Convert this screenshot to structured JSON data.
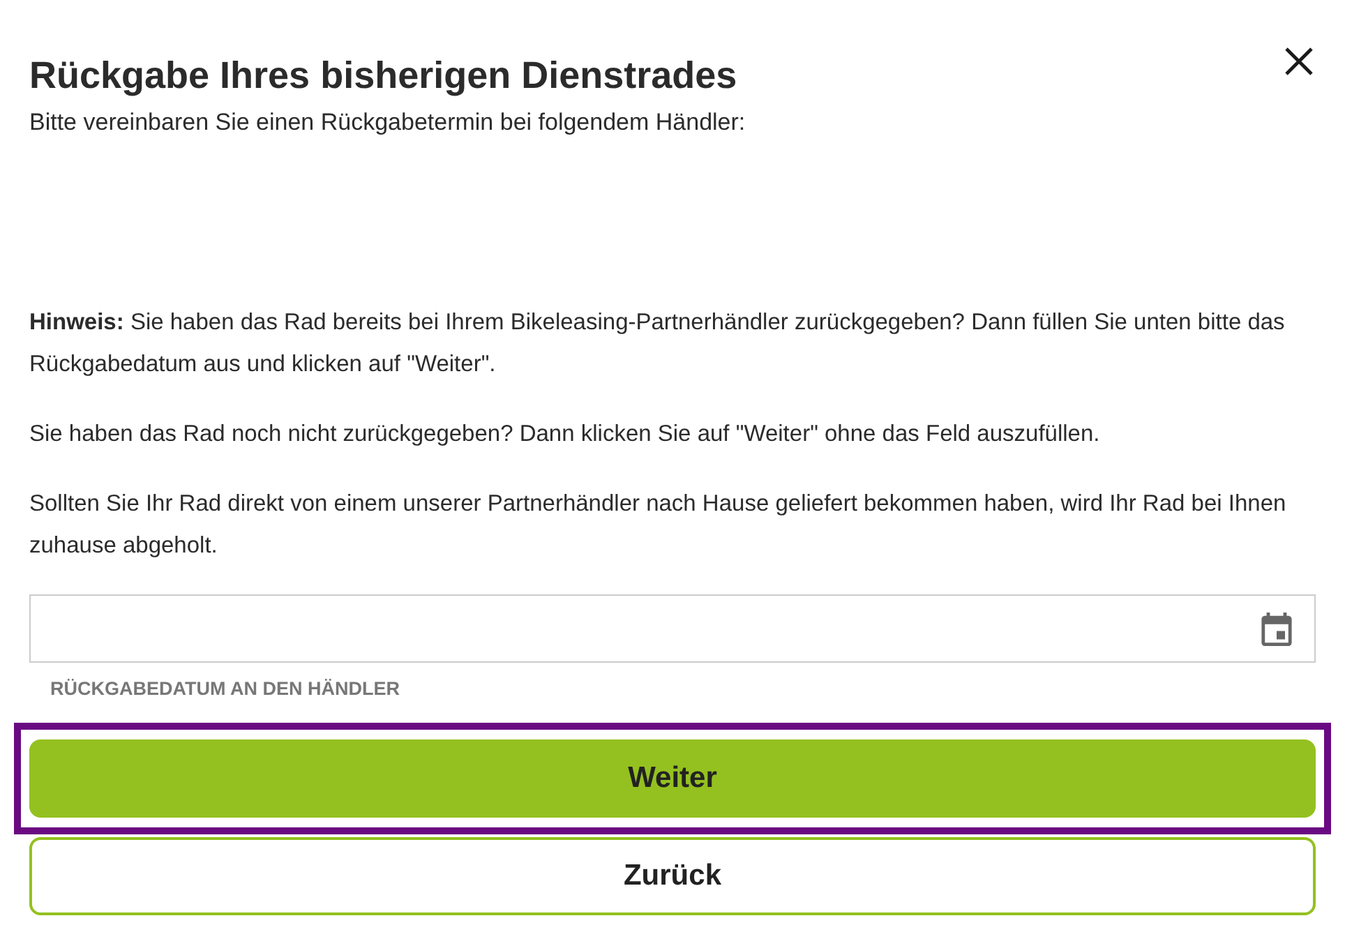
{
  "dialog": {
    "title": "Rückgabe Ihres bisherigen Dienstrades",
    "subtitle": "Bitte vereinbaren Sie einen Rückgabetermin bei folgendem Händler:"
  },
  "paragraphs": [
    {
      "text": "**Hinweis:** Sie haben das Rad bereits bei Ihrem Bikeleasing-Partnerhändler zurückgegeben? Dann füllen Sie unten bitte das Rückgabedatum aus und klicken auf \"Weiter\"."
    },
    {
      "text": "Sie haben das Rad noch nicht zurückgegeben? Dann klicken Sie auf \"Weiter\" ohne das Feld auszufüllen."
    },
    {
      "text": "Sollten Sie Ihr Rad direkt von einem unserer Partnerhändler nach Hause geliefert bekommen haben, wird Ihr Rad bei Ihnen zuhause abgeholt."
    }
  ],
  "date_field": {
    "label": "RÜCKGABEDATUM AN DEN HÄNDLER"
  },
  "buttons": [
    {
      "label": "Weiter",
      "kind": "primary",
      "focused": true
    },
    {
      "label": "Zurück",
      "kind": "secondary",
      "focused": false
    }
  ]
}
